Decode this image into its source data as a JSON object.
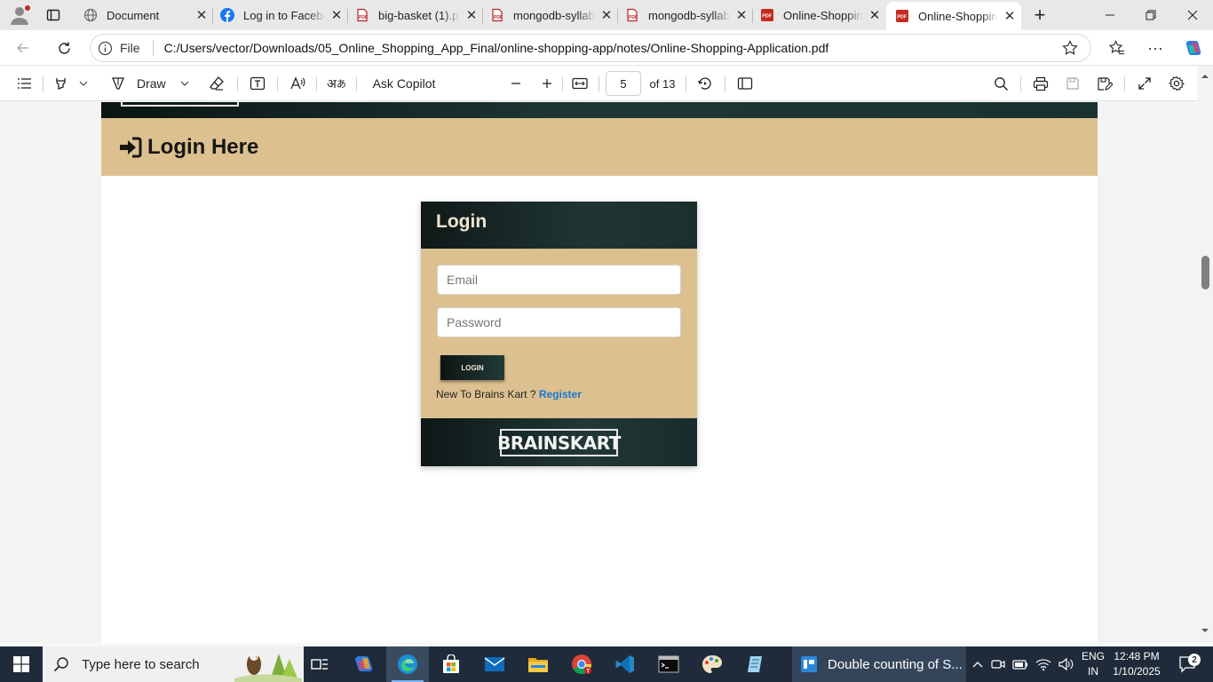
{
  "browser": {
    "tabs": [
      {
        "title": "Document",
        "icon": "globe-icon"
      },
      {
        "title": "Log in to Facebook",
        "icon": "facebook-icon"
      },
      {
        "title": "big-basket (1).pdf",
        "icon": "pdf-icon"
      },
      {
        "title": "mongodb-syllabus",
        "icon": "pdf-icon"
      },
      {
        "title": "mongodb-syllabus",
        "icon": "pdf-icon"
      },
      {
        "title": "Online-Shopping",
        "icon": "pdf-icon"
      },
      {
        "title": "Online-Shopping",
        "icon": "pdf-icon",
        "active": true
      }
    ],
    "address": {
      "scheme_label": "File",
      "url": "C:/Users/vector/Downloads/05_Online_Shopping_App_Final/online-shopping-app/notes/Online-Shopping-Application.pdf"
    }
  },
  "pdf_toolbar": {
    "draw_label": "Draw",
    "copilot_label": "Ask Copilot",
    "page_current": "5",
    "page_total_label": "of 13"
  },
  "document": {
    "section_heading": "Login Here",
    "card": {
      "title": "Login",
      "email_placeholder": "Email",
      "password_placeholder": "Password",
      "login_button": "LOGIN",
      "register_prompt": "New To Brains Kart ?",
      "register_link": "Register",
      "brand_logo": "BRAINSKART"
    },
    "colors": {
      "accent_tan": "#dcc08f",
      "dark_teal": "#1f3836",
      "link_blue": "#1976d2"
    }
  },
  "taskbar": {
    "search_placeholder": "Type here to search",
    "active_task_label": "Double counting of S...",
    "language": "ENG",
    "region": "IN",
    "time": "12:48 PM",
    "date": "1/10/2025",
    "notifications": "2"
  }
}
